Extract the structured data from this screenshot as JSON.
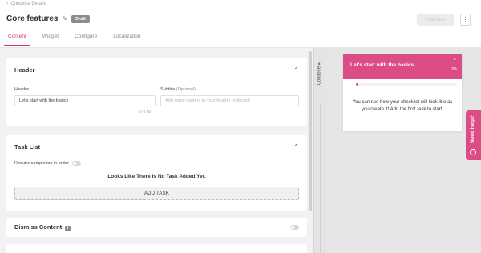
{
  "nav": {
    "back_label": "Checklist Details",
    "back_icon": "chevron-left-icon"
  },
  "header": {
    "title": "Core features",
    "status_badge": "Draft",
    "publish_label": "PUBLISH",
    "more_icon": "more-vertical-icon",
    "edit_icon": "pencil-icon"
  },
  "tabs": [
    {
      "label": "Content",
      "active": true
    },
    {
      "label": "Widget",
      "active": false
    },
    {
      "label": "Configure",
      "active": false
    },
    {
      "label": "Localization",
      "active": false
    }
  ],
  "sections": {
    "header": {
      "title": "Header",
      "header_label": "Header",
      "header_value": "Let's start with the basics",
      "subtitle_label": "Subtitle",
      "subtitle_optional": "(Optional)",
      "subtitle_placeholder": "Add some content to your header (optional)",
      "counter": "27 / 80"
    },
    "task_list": {
      "title": "Task List",
      "require_label": "Require completion in order",
      "require_enabled": false,
      "empty_message": "Looks Like There Is No Task Added Yet.",
      "add_task_label": "ADD TASK"
    },
    "dismiss": {
      "title": "Dismiss Content",
      "enabled": false
    }
  },
  "collapse": {
    "label": "Collapse",
    "icon": "collapse-icon"
  },
  "preview": {
    "title": "Let's start with the basics",
    "percent": "0%",
    "progress": 0,
    "body": "You can see how your checklist will look like as you create it! Add the first task to start.",
    "accent": "#dc4c87"
  },
  "help": {
    "label": "Need help?"
  },
  "colors": {
    "accent": "#d4346e",
    "widget_header": "#dc4c87",
    "badge": "#8c8c8c"
  }
}
